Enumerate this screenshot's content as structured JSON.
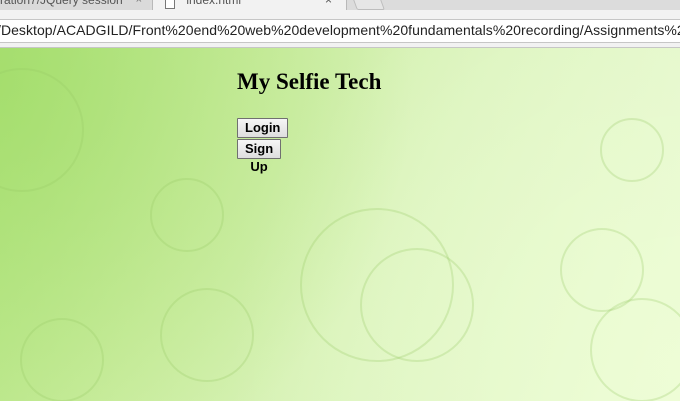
{
  "browser": {
    "tabs": [
      {
        "title": "ration7/JQuery session",
        "active": false,
        "close_glyph": "×"
      },
      {
        "title": "index.html",
        "active": true,
        "close_glyph": "×"
      }
    ],
    "address_bar": {
      "url": "/Desktop/ACADGILD/Front%20end%20web%20development%20fundamentals%20recording/Assignments%20"
    }
  },
  "page": {
    "background_color": "#cdeea3",
    "title": "My Selfie Tech",
    "buttons": {
      "login_label": "Login",
      "signup_label": "Sign Up"
    }
  }
}
